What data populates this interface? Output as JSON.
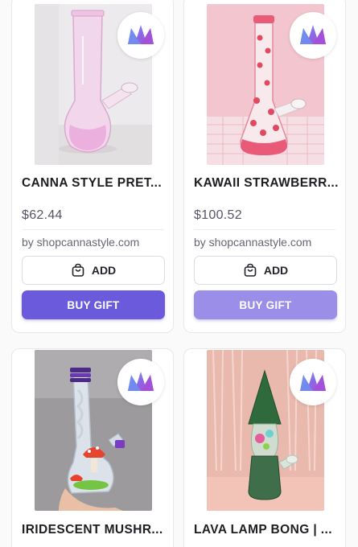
{
  "colors": {
    "buy_primary": "#6b5bdc",
    "buy_secondary": "#9a8ee8",
    "card_border": "#e7e7ec"
  },
  "products": [
    {
      "title": "CANNA STYLE PRET...",
      "price": "$62.44",
      "seller": "by shopcannastyle.com",
      "add_label": "ADD",
      "buy_label": "BUY GIFT",
      "badge_icon": "crown-logo-icon"
    },
    {
      "title": "KAWAII STRAWBERR...",
      "price": "$100.52",
      "seller": "by shopcannastyle.com",
      "add_label": "ADD",
      "buy_label": "BUY GIFT",
      "badge_icon": "crown-logo-icon"
    },
    {
      "title": "IRIDESCENT MUSHR...",
      "badge_icon": "crown-logo-icon"
    },
    {
      "title": "LAVA LAMP BONG | ...",
      "badge_icon": "crown-logo-icon"
    }
  ]
}
